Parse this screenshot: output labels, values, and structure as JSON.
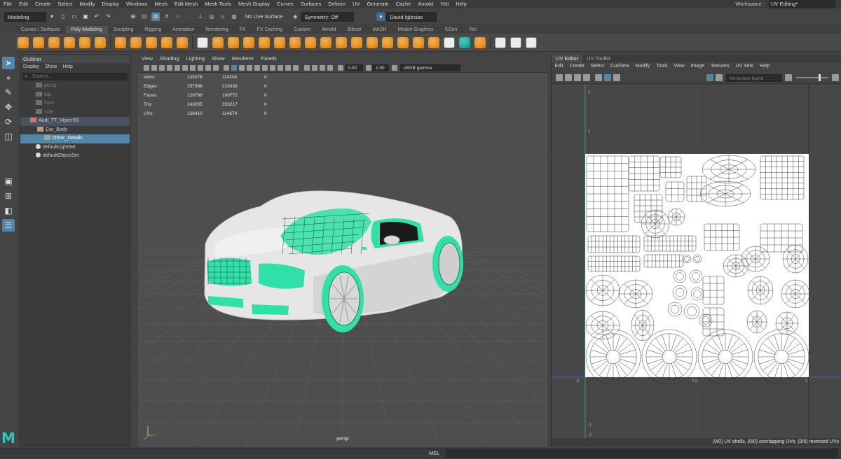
{
  "menubar": {
    "items": [
      "File",
      "Edit",
      "Create",
      "Select",
      "Modify",
      "Display",
      "Windows",
      "Mesh",
      "Edit Mesh",
      "Mesh Tools",
      "Mesh Display",
      "Curves",
      "Surfaces",
      "Deform",
      "UV",
      "Generate",
      "Cache",
      "Arnold",
      "Yeti",
      "Help"
    ],
    "workspace_label": "Workspace :",
    "workspace_value": "UV Editing*"
  },
  "statusline": {
    "mode": "Modeling",
    "live_surface": "No Live Surface",
    "symmetry": "Symmetry: Off",
    "user": "David Iglesias"
  },
  "shelf_tabs": {
    "tabs": [
      "Curves / Surfaces",
      "Poly Modeling",
      "Sculpting",
      "Rigging",
      "Animation",
      "Rendering",
      "FX",
      "FX Caching",
      "Custom",
      "Arnold",
      "Bifrost",
      "MASH",
      "Motion Graphics",
      "XGen",
      "Yeti"
    ],
    "active_index": 1
  },
  "shelf_icons": [
    "sphere-icon",
    "cube-icon",
    "cylinder-icon",
    "cone-icon",
    "plane-icon",
    "torus-icon",
    "disc-icon",
    "platonic-icon",
    "type-icon",
    "svg-icon",
    "sculpt-icon",
    "super-shape-icon",
    "combine-icon",
    "separate-icon",
    "smooth-icon",
    "boolean-icon",
    "mirror-icon",
    "extrude-icon",
    "bridge-icon",
    "bevel-icon",
    "fill-hole-icon",
    "multicut-icon",
    "target-weld-icon",
    "quad-draw-icon",
    "bevel-edge-icon",
    "merge-icon",
    "collapse-icon",
    "wedge-icon",
    "poke-icon",
    "lattice-icon",
    "uv-layout-icon",
    "uv-sew-icon",
    "auto-uv-icon"
  ],
  "outliner": {
    "title": "Outliner",
    "menu": [
      "Display",
      "Show",
      "Help"
    ],
    "search_placeholder": "Search...",
    "items": [
      {
        "label": "persp",
        "state": "dim",
        "indent": 22,
        "icon": "camera-icon"
      },
      {
        "label": "top",
        "state": "dim",
        "indent": 22,
        "icon": "camera-icon"
      },
      {
        "label": "front",
        "state": "dim",
        "indent": 22,
        "icon": "camera-icon"
      },
      {
        "label": "side",
        "state": "dim",
        "indent": 22,
        "icon": "camera-icon"
      },
      {
        "label": "Audi_TT_Viperr3D",
        "state": "hl",
        "indent": 14,
        "icon": "group-icon"
      },
      {
        "label": "Car_Body",
        "state": "normal",
        "indent": 24,
        "icon": "mesh-icon"
      },
      {
        "label": "Other_Details",
        "state": "sel",
        "indent": 34,
        "icon": "mesh-icon"
      },
      {
        "label": "defaultLightSet",
        "state": "normal",
        "indent": 22,
        "icon": "set-icon"
      },
      {
        "label": "defaultObjectSet",
        "state": "normal",
        "indent": 22,
        "icon": "set-icon"
      }
    ]
  },
  "viewport": {
    "menu": [
      "View",
      "Shading",
      "Lighting",
      "Show",
      "Renderer",
      "Panels"
    ],
    "exposure": "0.00",
    "gamma": "1.00",
    "color_space": "sRGB gamma",
    "camera": "persp",
    "hud": [
      {
        "label": "Verts:",
        "a": "135276",
        "b": "114204",
        "c": "0"
      },
      {
        "label": "Edges:",
        "a": "257388",
        "b": "216339",
        "c": "0"
      },
      {
        "label": "Faces:",
        "a": "120766",
        "b": "100772",
        "c": "0"
      },
      {
        "label": "Tris:",
        "a": "243205",
        "b": "203217",
        "c": "0"
      },
      {
        "label": "UVs:",
        "a": "136410",
        "b": "114674",
        "c": "0"
      }
    ],
    "accent": "#2fe0a8"
  },
  "uv_editor": {
    "tabs": [
      "UV Editor",
      "UV Toolkit"
    ],
    "menu": [
      "Edit",
      "Create",
      "Select",
      "Cut/Sew",
      "Modify",
      "Tools",
      "View",
      "Image",
      "Textures",
      "UV Sets",
      "Help"
    ],
    "texture": "No texture found",
    "axis_labels": [
      "2",
      "1",
      "0",
      "0.5",
      "1",
      "-1",
      "-2"
    ],
    "status": "(0/0) UV shells, (0/0) overlapping UVs, (0/0) reversed UVs"
  },
  "bottom": {
    "mel_label": "MEL"
  }
}
